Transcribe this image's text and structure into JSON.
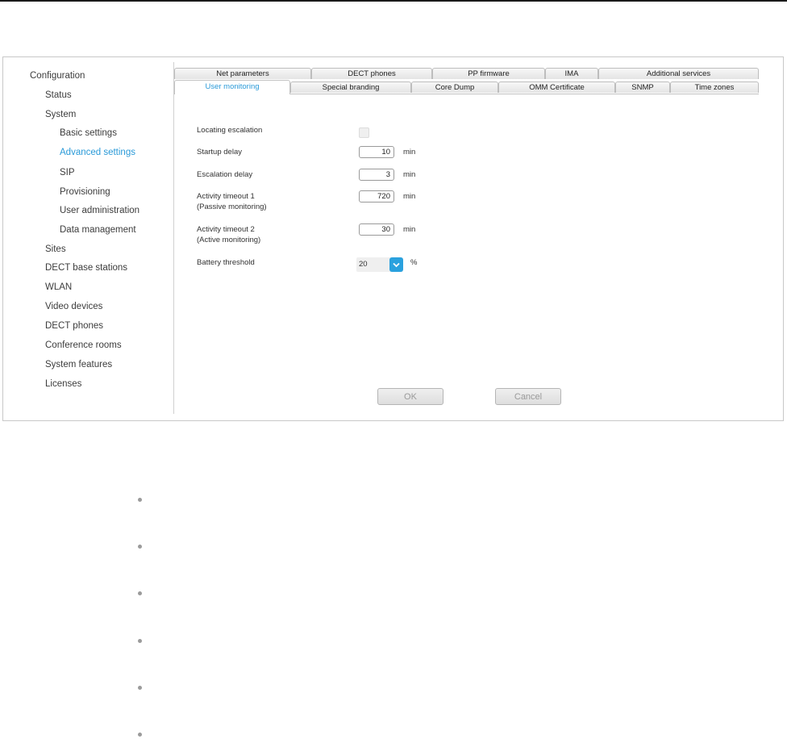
{
  "sidebar": {
    "root": "Configuration",
    "items": [
      {
        "label": "Status",
        "level": 1,
        "active": false
      },
      {
        "label": "System",
        "level": 1,
        "active": false
      },
      {
        "label": "Basic settings",
        "level": 2,
        "active": false
      },
      {
        "label": "Advanced settings",
        "level": 2,
        "active": true
      },
      {
        "label": "SIP",
        "level": 2,
        "active": false
      },
      {
        "label": "Provisioning",
        "level": 2,
        "active": false
      },
      {
        "label": "User administration",
        "level": 2,
        "active": false
      },
      {
        "label": "Data management",
        "level": 2,
        "active": false
      },
      {
        "label": "Sites",
        "level": 1,
        "active": false
      },
      {
        "label": "DECT base stations",
        "level": 1,
        "active": false
      },
      {
        "label": "WLAN",
        "level": 1,
        "active": false
      },
      {
        "label": "Video devices",
        "level": 1,
        "active": false
      },
      {
        "label": "DECT phones",
        "level": 1,
        "active": false
      },
      {
        "label": "Conference rooms",
        "level": 1,
        "active": false
      },
      {
        "label": "System features",
        "level": 1,
        "active": false
      },
      {
        "label": "Licenses",
        "level": 1,
        "active": false
      }
    ]
  },
  "tabs": {
    "back_row": [
      "Net parameters",
      "DECT phones",
      "PP firmware",
      "IMA",
      "Additional services"
    ],
    "front_row": [
      "User monitoring",
      "Special branding",
      "Core Dump",
      "OMM Certificate",
      "SNMP",
      "Time zones"
    ],
    "active": "User monitoring"
  },
  "form": {
    "locating_escalation": {
      "label": "Locating escalation",
      "checked": false
    },
    "startup_delay": {
      "label": "Startup delay",
      "value": "10",
      "unit": "min"
    },
    "escalation_delay": {
      "label": "Escalation delay",
      "value": "3",
      "unit": "min"
    },
    "activity_timeout_1": {
      "label": "Activity timeout 1",
      "sublabel": "(Passive monitoring)",
      "value": "720",
      "unit": "min"
    },
    "activity_timeout_2": {
      "label": "Activity timeout 2",
      "sublabel": "(Active monitoring)",
      "value": "30",
      "unit": "min"
    },
    "battery_threshold": {
      "label": "Battery threshold",
      "value": "20",
      "unit": "%"
    }
  },
  "buttons": {
    "ok": "OK",
    "cancel": "Cancel"
  },
  "colors": {
    "accent": "#2a9ad8",
    "select_button": "#2aa1de"
  },
  "icons": {
    "select_arrow": "chevron-down-icon",
    "bullet": "bullet-icon"
  },
  "bullets_count": 6
}
